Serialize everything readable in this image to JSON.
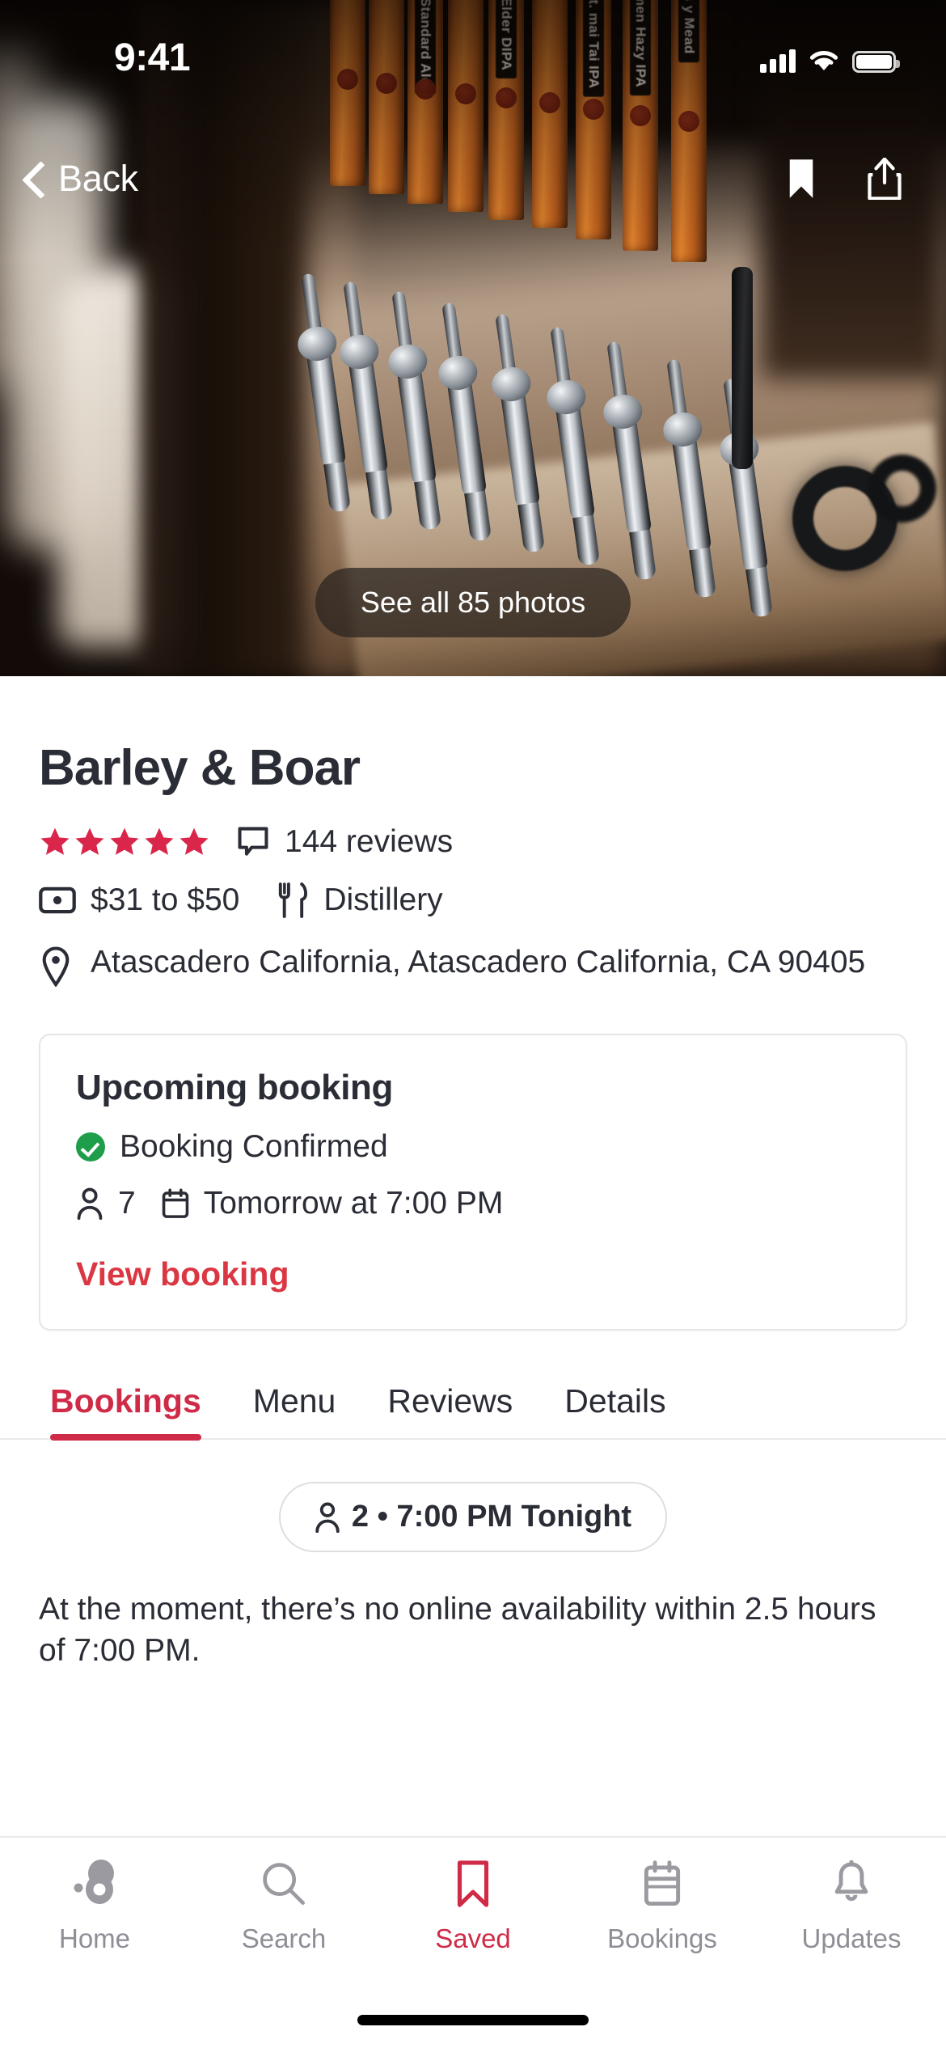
{
  "status_bar": {
    "time": "9:41",
    "signal_icon": "cellular-signal-icon",
    "wifi_icon": "wifi-icon",
    "battery_icon": "battery-icon"
  },
  "nav": {
    "back_label": "Back",
    "save_icon": "bookmark-icon",
    "share_icon": "share-icon"
  },
  "hero": {
    "photos_button": "See all 85 photos",
    "tap_labels": [
      "Barrelhouse Standard Ale",
      "Pliny the Elder DIPA",
      "Alvarado St. mai Tai IPA",
      "Draughtsmen Hazy IPA",
      "Apis y Mead"
    ]
  },
  "restaurant": {
    "name": "Barley & Boar",
    "rating": 5,
    "reviews_text": "144 reviews",
    "price_range": "$31 to $50",
    "cuisine": "Distillery",
    "address": "Atascadero California, Atascadero California, CA 90405"
  },
  "booking_card": {
    "heading": "Upcoming booking",
    "status": "Booking Confirmed",
    "party_size": "7",
    "when": "Tomorrow at 7:00 PM",
    "link": "View booking"
  },
  "tabs": [
    {
      "label": "Bookings",
      "active": true
    },
    {
      "label": "Menu",
      "active": false
    },
    {
      "label": "Reviews",
      "active": false
    },
    {
      "label": "Details",
      "active": false
    }
  ],
  "availability": {
    "party_pill": "2 • 7:00 PM Tonight",
    "message": "At the moment, there’s no online availability within 2.5 hours of 7:00 PM."
  },
  "bottom_nav": [
    {
      "label": "Home",
      "icon": "opentable-logo-icon",
      "active": false
    },
    {
      "label": "Search",
      "icon": "search-icon",
      "active": false
    },
    {
      "label": "Saved",
      "icon": "bookmark-icon",
      "active": true
    },
    {
      "label": "Bookings",
      "icon": "calendar-icon",
      "active": false
    },
    {
      "label": "Updates",
      "icon": "bell-icon",
      "active": false
    }
  ],
  "colors": {
    "accent_red": "#CF2B47",
    "link_red": "#DA3743",
    "text_dark": "#2B2D36",
    "muted_gray": "#8E8E96",
    "confirm_green": "#1E9E4A"
  }
}
